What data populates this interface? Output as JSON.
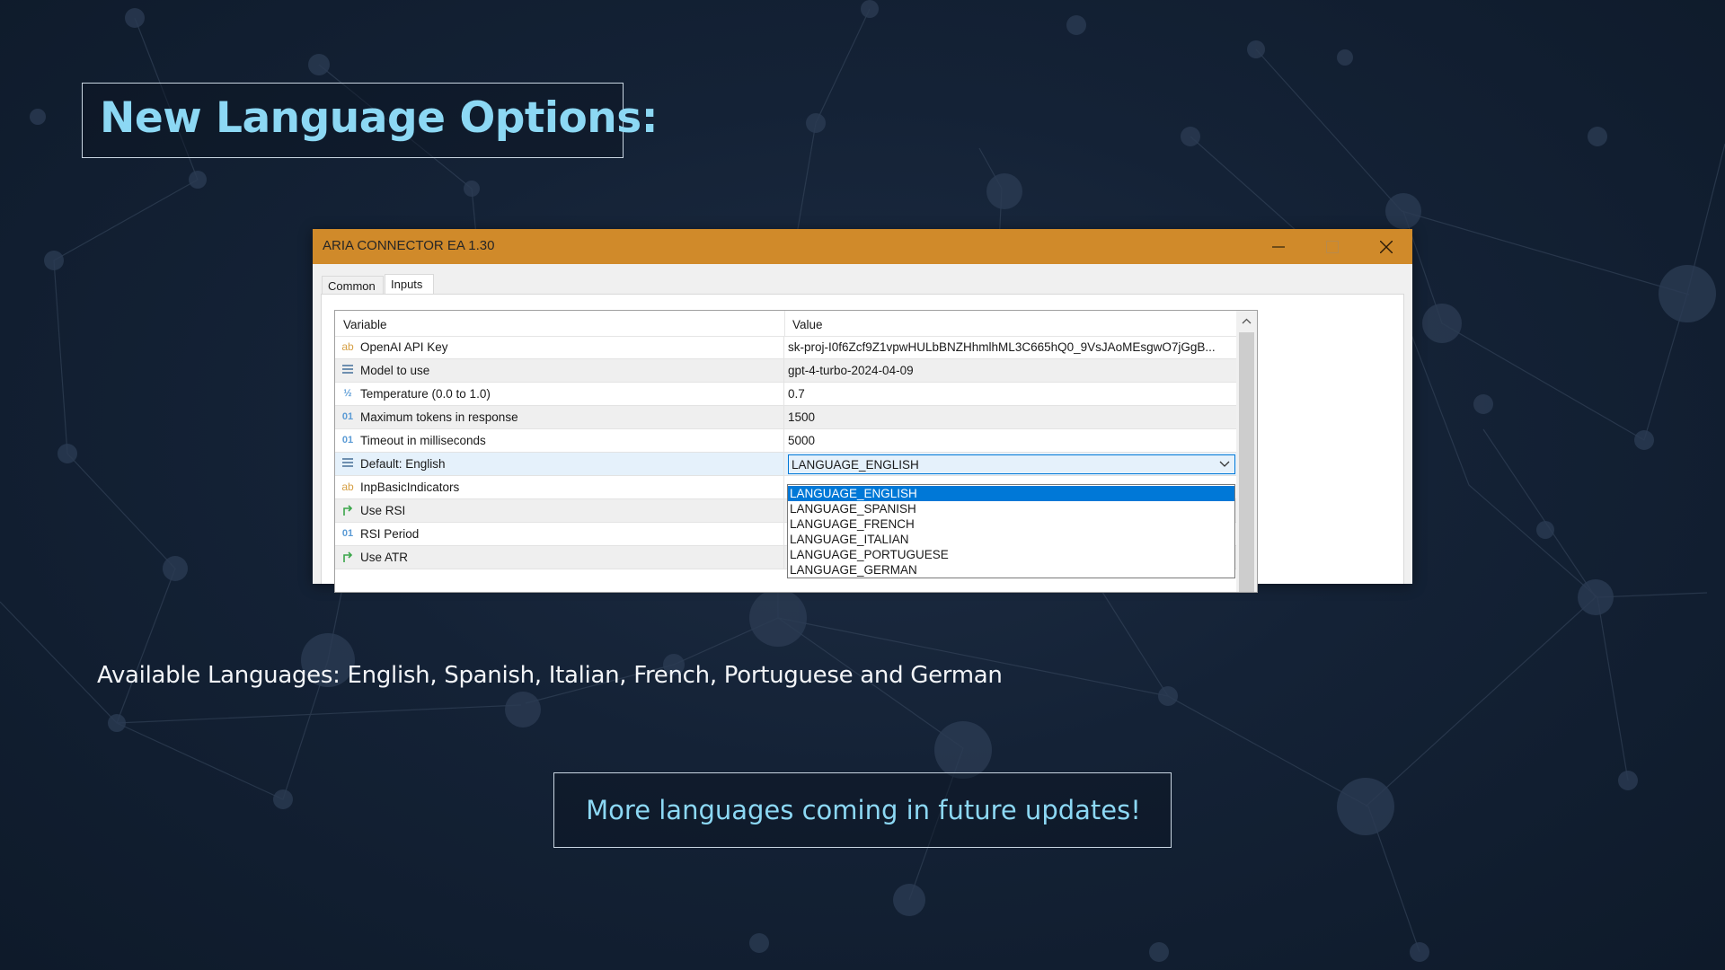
{
  "slide": {
    "heading": "New Language Options:",
    "caption": "Available Languages: English, Spanish, Italian, French, Portuguese and German",
    "callout": "More languages coming in future updates!",
    "accent_color": "#8cd8f4"
  },
  "window": {
    "title": "ARIA CONNECTOR EA 1.30",
    "titlebar_color": "#d08a2a",
    "tabs": [
      {
        "label": "Common",
        "selected": false
      },
      {
        "label": "Inputs",
        "selected": true
      }
    ],
    "table": {
      "columns": [
        "Variable",
        "Value"
      ],
      "rows": [
        {
          "icon": "text-type-icon",
          "glyph": "ab",
          "variable": "OpenAI API Key",
          "value": "sk-proj-I0f6Zcf9Z1vpwHULbBNZHhmlhML3C665hQ0_9VsJAoMEsgwO7jGgB..."
        },
        {
          "icon": "enum-type-icon",
          "glyph": "",
          "variable": "Model to use",
          "value": "gpt-4-turbo-2024-04-09"
        },
        {
          "icon": "fraction-type-icon",
          "glyph": "½",
          "variable": "Temperature (0.0 to 1.0)",
          "value": "0.7"
        },
        {
          "icon": "integer-type-icon",
          "glyph": "01",
          "variable": "Maximum tokens in response",
          "value": "1500"
        },
        {
          "icon": "integer-type-icon",
          "glyph": "01",
          "variable": "Timeout in milliseconds",
          "value": "5000"
        },
        {
          "icon": "enum-type-icon",
          "glyph": "",
          "variable": "Default: English",
          "value": "LANGUAGE_ENGLISH"
        },
        {
          "icon": "text-type-icon",
          "glyph": "ab",
          "variable": "InpBasicIndicators",
          "value": ""
        },
        {
          "icon": "boolean-type-icon",
          "glyph": "",
          "variable": "Use RSI",
          "value": ""
        },
        {
          "icon": "integer-type-icon",
          "glyph": "01",
          "variable": "RSI Period",
          "value": ""
        },
        {
          "icon": "boolean-type-icon",
          "glyph": "",
          "variable": "Use ATR",
          "value": ""
        }
      ]
    },
    "language_dropdown": {
      "selected": "LANGUAGE_ENGLISH",
      "options": [
        "LANGUAGE_ENGLISH",
        "LANGUAGE_SPANISH",
        "LANGUAGE_FRENCH",
        "LANGUAGE_ITALIAN",
        "LANGUAGE_PORTUGUESE",
        "LANGUAGE_GERMAN"
      ]
    }
  }
}
